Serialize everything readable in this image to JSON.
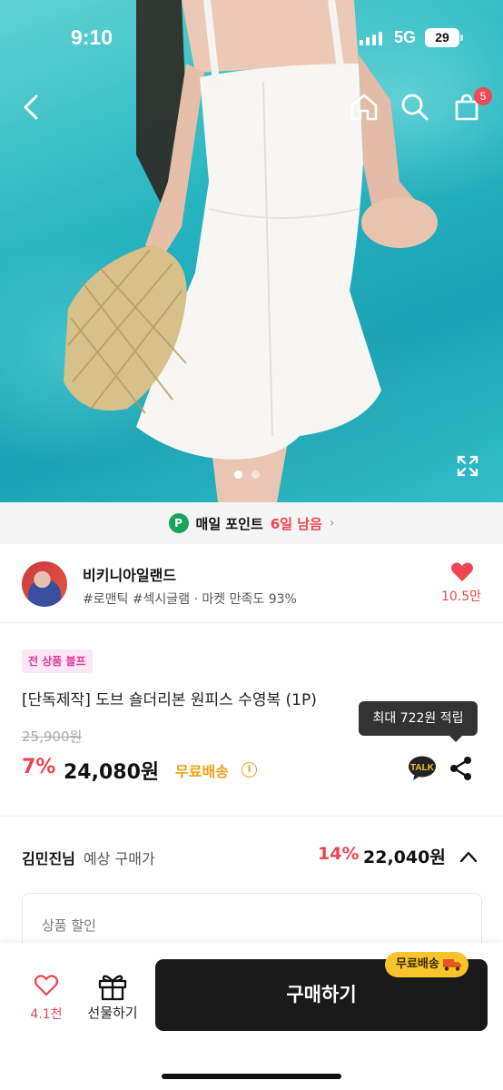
{
  "status": {
    "time": "9:10",
    "network": "5G",
    "battery": "29"
  },
  "nav": {
    "cart_count": "5"
  },
  "points_banner": {
    "badge": "P",
    "label": "매일 포인트",
    "highlight": "6일 남음"
  },
  "shop": {
    "name": "비키니아일랜드",
    "tags": "#로맨틱 #섹시글램 · 마켓 만족도 93%",
    "likes": "10.5만"
  },
  "product": {
    "tag": "전 상품 블프",
    "title": "[단독제작] 도브 숄더리본 원피스 수영복 (1P)",
    "original_price": "25,900원",
    "discount": "7%",
    "price": "24,080원",
    "shipping": "무료배송",
    "tooltip": "최대 722원 적립",
    "talk_label": "TALK"
  },
  "expected": {
    "name": "김민진님",
    "label": "예상 구매가",
    "discount": "14%",
    "price": "22,040원"
  },
  "discount_box": {
    "label": "상품 할인"
  },
  "bottom": {
    "likes": "4.1천",
    "gift_label": "선물하기",
    "buy_label": "구매하기",
    "free_badge": "무료배송"
  },
  "colors": {
    "accent": "#ef4452",
    "shipping": "#f0a019",
    "badge_yellow": "#f7c42c",
    "buy_button": "#1a1a1a",
    "points_green": "#1ba45b"
  }
}
